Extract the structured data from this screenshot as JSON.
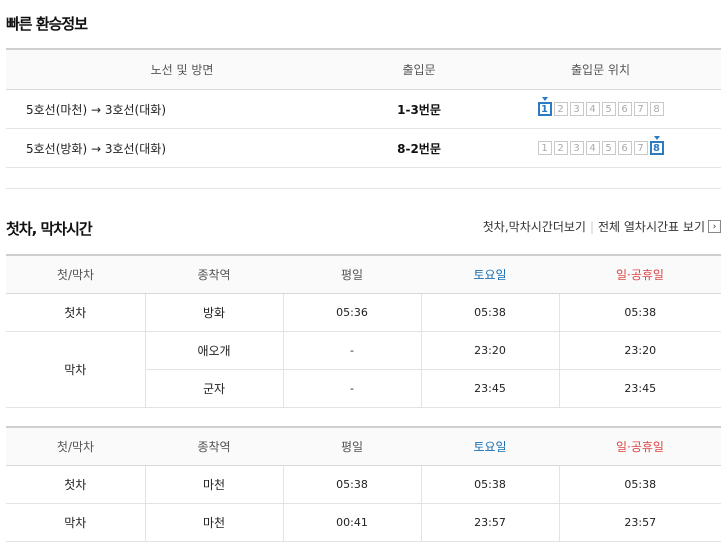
{
  "transfer": {
    "title": "빠른 환승정보",
    "headers": {
      "route": "노선 및 방면",
      "exit": "출입문",
      "position": "출입문 위치"
    },
    "rows": [
      {
        "route": "5호선(마천) → 3호선(대화)",
        "exit": "1-3번문",
        "doors": [
          "1",
          "2",
          "3",
          "4",
          "5",
          "6",
          "7",
          "8"
        ],
        "active_door": "1"
      },
      {
        "route": "5호선(방화) → 3호선(대화)",
        "exit": "8-2번문",
        "doors": [
          "1",
          "2",
          "3",
          "4",
          "5",
          "6",
          "7",
          "8"
        ],
        "active_door": "8"
      }
    ]
  },
  "timetable": {
    "title": "첫차, 막차시간",
    "links": {
      "first_last_more": "첫차,막차시간더보기",
      "full_table": "전체 열차시간표 보기"
    },
    "headers": {
      "kind": "첫/막차",
      "terminal": "종착역",
      "weekday": "평일",
      "saturday": "토요일",
      "holiday": "일·공휴일"
    },
    "colors": {
      "saturday": "#1a6fb3",
      "holiday": "#dd4444",
      "active_door": "#2b7bc4"
    },
    "table1": {
      "first": {
        "kind": "첫차",
        "terminal": "방화",
        "weekday": "05:36",
        "saturday": "05:38",
        "holiday": "05:38"
      },
      "last_kind": "막차",
      "last": [
        {
          "terminal": "애오개",
          "weekday": "-",
          "saturday": "23:20",
          "holiday": "23:20"
        },
        {
          "terminal": "군자",
          "weekday": "-",
          "saturday": "23:45",
          "holiday": "23:45"
        }
      ]
    },
    "table2": {
      "first": {
        "kind": "첫차",
        "terminal": "마천",
        "weekday": "05:38",
        "saturday": "05:38",
        "holiday": "05:38"
      },
      "last": {
        "kind": "막차",
        "terminal": "마천",
        "weekday": "00:41",
        "saturday": "23:57",
        "holiday": "23:57"
      }
    }
  }
}
